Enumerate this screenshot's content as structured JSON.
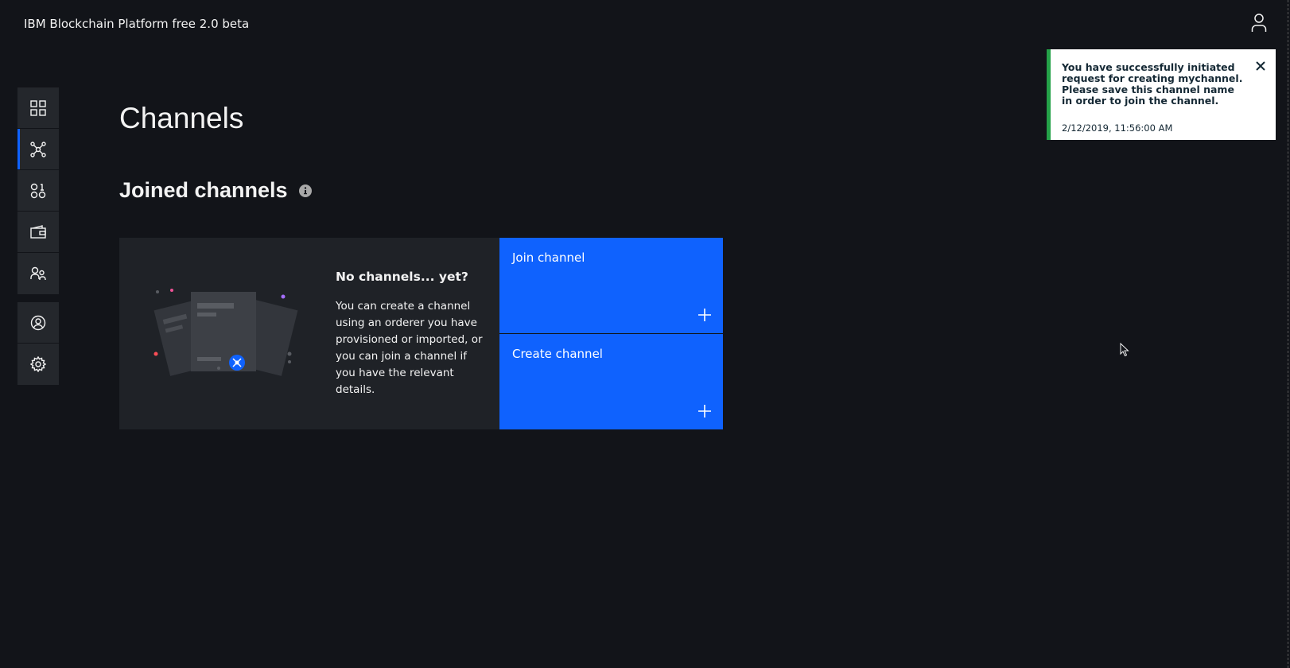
{
  "header": {
    "app_title": "IBM Blockchain Platform free 2.0 beta",
    "user_icon": "user-icon"
  },
  "sidebar": {
    "groups": [
      [
        {
          "name": "nodes",
          "icon": "dashboard-grid-icon",
          "active": false
        },
        {
          "name": "channels",
          "icon": "network-icon",
          "active": true
        },
        {
          "name": "smart-contracts",
          "icon": "smart-contracts-icon",
          "active": false
        },
        {
          "name": "wallet",
          "icon": "wallet-icon",
          "active": false
        },
        {
          "name": "organizations",
          "icon": "organizations-icon",
          "active": false
        }
      ],
      [
        {
          "name": "users",
          "icon": "user-avatar-icon",
          "active": false
        },
        {
          "name": "settings",
          "icon": "gear-icon",
          "active": false
        }
      ]
    ]
  },
  "main": {
    "page_title": "Channels",
    "section_title": "Joined channels",
    "empty_state": {
      "title": "No channels... yet?",
      "description": "You can create a channel using an orderer you have provisioned or imported, or you can join a channel if you have the relevant details."
    },
    "tiles": {
      "join_label": "Join channel",
      "create_label": "Create channel"
    }
  },
  "toast": {
    "message": "You have successfully initiated request for creating mychannel. Please save this channel name in order to join the channel.",
    "timestamp": "2/12/2019, 11:56:00 AM",
    "status_color": "#24a148"
  },
  "colors": {
    "accent": "#0f62fe",
    "background": "#121419",
    "panel": "#24272c"
  }
}
